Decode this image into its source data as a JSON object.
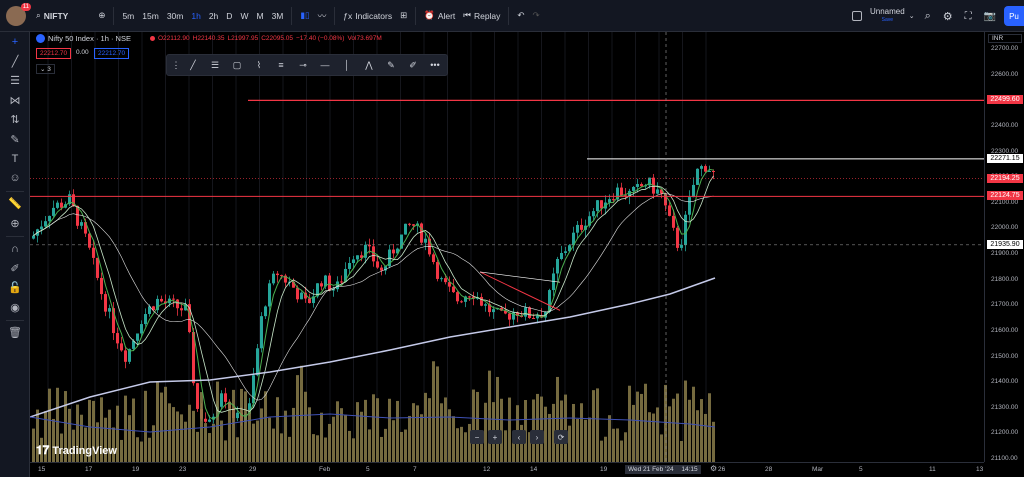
{
  "topbar": {
    "avatar_badge": "11",
    "symbol": "NIFTY",
    "intervals": [
      "5m",
      "15m",
      "30m",
      "1h",
      "2h",
      "D",
      "W",
      "M",
      "3M"
    ],
    "active_interval": "1h",
    "indicators_label": "Indicators",
    "alert_label": "Alert",
    "replay_label": "Replay",
    "layout_name": "Unnamed",
    "layout_status": "Save",
    "publish_label": "Pu"
  },
  "legend": {
    "title": "Nifty 50 Index · 1h · NSE",
    "o": "O22112.90",
    "h": "H22140.35",
    "l": "L21997.95",
    "c": "C22095.05",
    "chg": "−17.40 (−0.08%)",
    "vol": "Vol73.697M",
    "sell_price": "22212.70",
    "spread": "0.00",
    "buy_price": "22212.70",
    "indicator_count": "3"
  },
  "price_axis": {
    "currency": "INR",
    "ticks": [
      "22700.00",
      "22600.00",
      "22500.00",
      "22400.00",
      "22300.00",
      "22200.00",
      "22100.00",
      "22000.00",
      "21900.00",
      "21800.00",
      "21700.00",
      "21600.00",
      "21500.00",
      "21400.00",
      "21300.00",
      "21200.00",
      "21100.00"
    ],
    "labels": [
      {
        "text": "22499.60",
        "color": "#f23645"
      },
      {
        "text": "22271.15",
        "color": "#ffffff"
      },
      {
        "text": "22194.25",
        "color": "#f23645"
      },
      {
        "text": "22124.75",
        "color": "#f23645"
      },
      {
        "text": "21935.90",
        "color": "#ffffff"
      }
    ]
  },
  "time_axis": {
    "labels": [
      "15",
      "17",
      "19",
      "23",
      "29",
      "Feb",
      "5",
      "7",
      "12",
      "14",
      "19",
      "26",
      "28",
      "Mar",
      "5",
      "11",
      "13"
    ],
    "cursor": "Wed 21 Feb '24",
    "cursor_time": "14:15"
  },
  "logo": "TradingView",
  "colors": {
    "up": "#26a69a",
    "down": "#f23645",
    "volume": "#8a7d4a",
    "accent": "#2962ff"
  }
}
